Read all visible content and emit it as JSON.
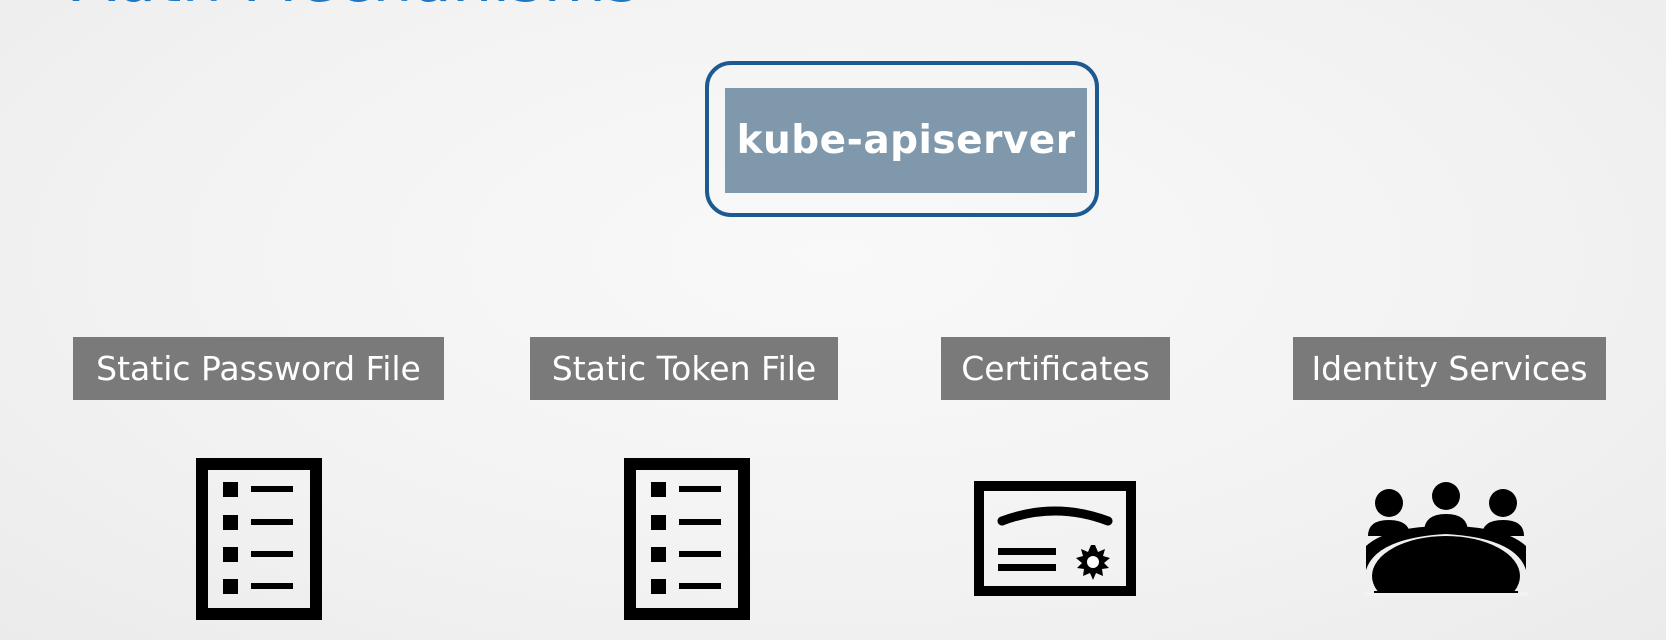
{
  "slide": {
    "title_fragment": "Auth Mechanisms"
  },
  "server": {
    "label": "kube-apiserver"
  },
  "mechanisms": [
    {
      "label": "Static Password File",
      "icon": "list-document-icon"
    },
    {
      "label": "Static Token File",
      "icon": "list-document-icon"
    },
    {
      "label": "Certificates",
      "icon": "certificate-icon"
    },
    {
      "label": "Identity Services",
      "icon": "group-meeting-icon"
    }
  ],
  "colors": {
    "title_blue": "#1f77c4",
    "server_border": "#1c5a91",
    "server_fill": "#8098ac",
    "label_bg": "#7a7a7a",
    "icon": "#000000"
  }
}
